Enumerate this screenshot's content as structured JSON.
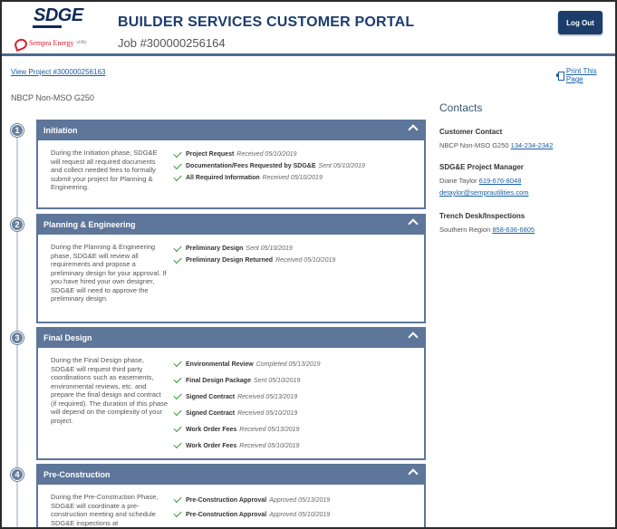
{
  "header": {
    "logo_text": "SDGE",
    "logo_sub": "Sempra Energy",
    "logo_sub_small": "utility",
    "title": "BUILDER SERVICES CUSTOMER PORTAL",
    "job": "Job #300000256164",
    "logout_label": "Log Out"
  },
  "top_links": {
    "view_project": "View Project #300000256163",
    "print": "Print This Page"
  },
  "project_name": "NBCP Non-MSO G250",
  "phases": [
    {
      "number": "1",
      "title": "Initiation",
      "description": "During the Initiation phase, SDG&E will request all required documents and collect needed fees to formally submit your project for Planning & Engineering.",
      "items": [
        {
          "name": "Project Request",
          "status": "Received 05/10/2019"
        },
        {
          "name": "Documentation/Fees Requested by SDG&E",
          "status": "Sent 05/10/2019"
        },
        {
          "name": "All Required Information",
          "status": "Received 05/10/2019"
        }
      ]
    },
    {
      "number": "2",
      "title": "Planning & Engineering",
      "description": "During the Planning & Engineering phase, SDG&E will review all requirements and propose a preliminary design for your approval. If you have hired your own designer, SDG&E will need to approve the preliminary design.",
      "items": [
        {
          "name": "Preliminary Design",
          "status": "Sent 05/10/2019"
        },
        {
          "name": "Preliminary Design Returned",
          "status": "Received 05/10/2019"
        }
      ]
    },
    {
      "number": "3",
      "title": "Final Design",
      "description": "During the Final Design phase, SDG&E will request third party coordinations such as easements, environmental reviews, etc. and prepare the final design and contract (if required). The duration of this phase will depend on the complexity of your project.",
      "items": [
        {
          "name": "Environmental Review",
          "status": "Completed 05/13/2019"
        },
        {
          "name": "Final Design Package",
          "status": "Sent 05/10/2019"
        },
        {
          "name": "Signed Contract",
          "status": "Received 05/13/2019"
        },
        {
          "name": "Signed Contract",
          "status": "Received 05/10/2019"
        },
        {
          "name": "Work Order Fees",
          "status": "Received 05/13/2019"
        },
        {
          "name": "Work Order Fees",
          "status": "Received 05/10/2019"
        }
      ]
    },
    {
      "number": "4",
      "title": "Pre-Construction",
      "description": "During the Pre-Construction Phase, SDG&E will coordinate a pre-construction meeting and schedule SDG&E inspections at",
      "items": [
        {
          "name": "Pre-Construction Approval",
          "status": "Approved 05/13/2019"
        },
        {
          "name": "Pre-Construction Approval",
          "status": "Approved 05/10/2019"
        }
      ]
    }
  ],
  "contacts": {
    "title": "Contacts",
    "customer": {
      "heading": "Customer Contact",
      "name": "NBCP Non-MSO G250",
      "phone": "134-234-2342"
    },
    "manager": {
      "heading": "SDG&E Project Manager",
      "name": "Diane Taylor",
      "phone": "619-676-8048",
      "email": "detaylor@semprautilities.com"
    },
    "trench": {
      "heading": "Trench Desk/Inspections",
      "name": "Southern Region",
      "phone": "858-636-6805"
    }
  },
  "colors": {
    "header_bar": "#5d7699",
    "brand_navy": "#1c3d6a",
    "link": "#1a5fa8",
    "check": "#3a9b3a"
  }
}
